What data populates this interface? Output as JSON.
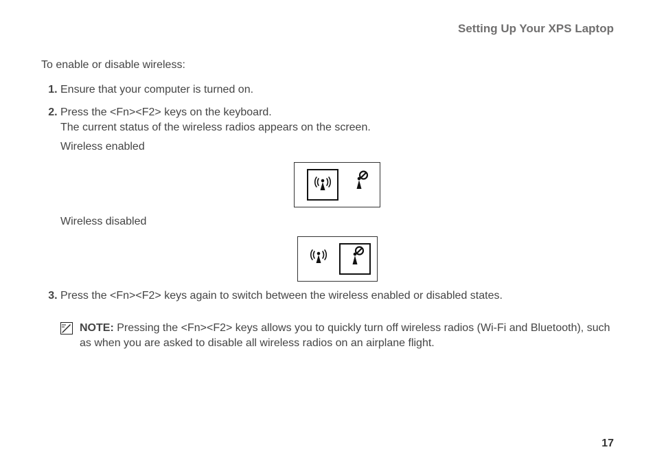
{
  "runningHeader": "Setting Up Your XPS Laptop",
  "lead": "To enable or disable wireless:",
  "steps": {
    "s1": "Ensure that your computer is turned on.",
    "s2a": "Press the <Fn><F2> keys on the keyboard.",
    "s2b": "The current status of the wireless radios appears on the screen.",
    "enabledLabel": "Wireless enabled",
    "disabledLabel": "Wireless disabled",
    "s3": "Press the <Fn><F2> keys again to switch between the wireless enabled or disabled states."
  },
  "note": {
    "label": "NOTE:",
    "text": "Pressing the <Fn><F2> keys allows you to quickly turn off wireless radios (Wi-Fi and Bluetooth), such as when you are asked to disable all wireless radios on an airplane flight."
  },
  "pageNumber": "17"
}
